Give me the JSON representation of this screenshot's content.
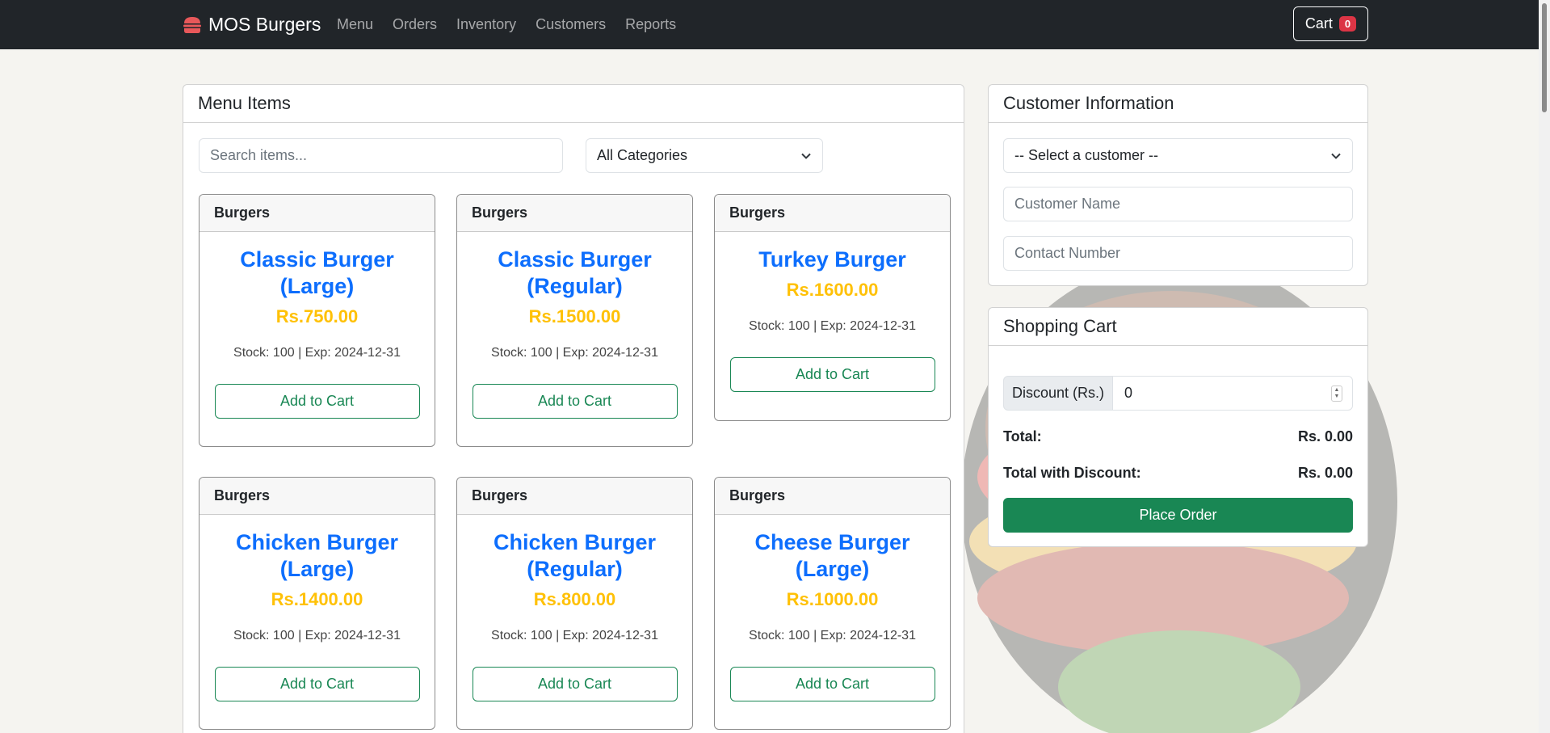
{
  "navbar": {
    "brand": "MOS Burgers",
    "links": [
      "Menu",
      "Orders",
      "Inventory",
      "Customers",
      "Reports"
    ],
    "cart_label": "Cart",
    "cart_count": "0"
  },
  "menu": {
    "title": "Menu Items",
    "search_placeholder": "Search items...",
    "category_selected": "All Categories",
    "items": [
      {
        "category": "Burgers",
        "name": "Classic Burger (Large)",
        "price": "Rs.750.00",
        "stock": "Stock: 100 | Exp: 2024-12-31",
        "button": "Add to Cart"
      },
      {
        "category": "Burgers",
        "name": "Classic Burger (Regular)",
        "price": "Rs.1500.00",
        "stock": "Stock: 100 | Exp: 2024-12-31",
        "button": "Add to Cart"
      },
      {
        "category": "Burgers",
        "name": "Turkey Burger",
        "price": "Rs.1600.00",
        "stock": "Stock: 100 | Exp: 2024-12-31",
        "button": "Add to Cart"
      },
      {
        "category": "Burgers",
        "name": "Chicken Burger (Large)",
        "price": "Rs.1400.00",
        "stock": "Stock: 100 | Exp: 2024-12-31",
        "button": "Add to Cart"
      },
      {
        "category": "Burgers",
        "name": "Chicken Burger (Regular)",
        "price": "Rs.800.00",
        "stock": "Stock: 100 | Exp: 2024-12-31",
        "button": "Add to Cart"
      },
      {
        "category": "Burgers",
        "name": "Cheese Burger (Large)",
        "price": "Rs.1000.00",
        "stock": "Stock: 100 | Exp: 2024-12-31",
        "button": "Add to Cart"
      }
    ]
  },
  "customer": {
    "title": "Customer Information",
    "select_value": "-- Select a customer --",
    "name_placeholder": "Customer Name",
    "contact_placeholder": "Contact Number"
  },
  "cart": {
    "title": "Shopping Cart",
    "discount_label": "Discount (Rs.)",
    "discount_value": "0",
    "total_label": "Total:",
    "total_value": "Rs. 0.00",
    "total_discount_label": "Total with Discount:",
    "total_discount_value": "Rs. 0.00",
    "place_order": "Place Order"
  },
  "colors": {
    "navbar": "#212529",
    "primary_text": "#0d6efd",
    "price": "#ffc107",
    "success": "#198754",
    "badge": "#dc3545"
  }
}
